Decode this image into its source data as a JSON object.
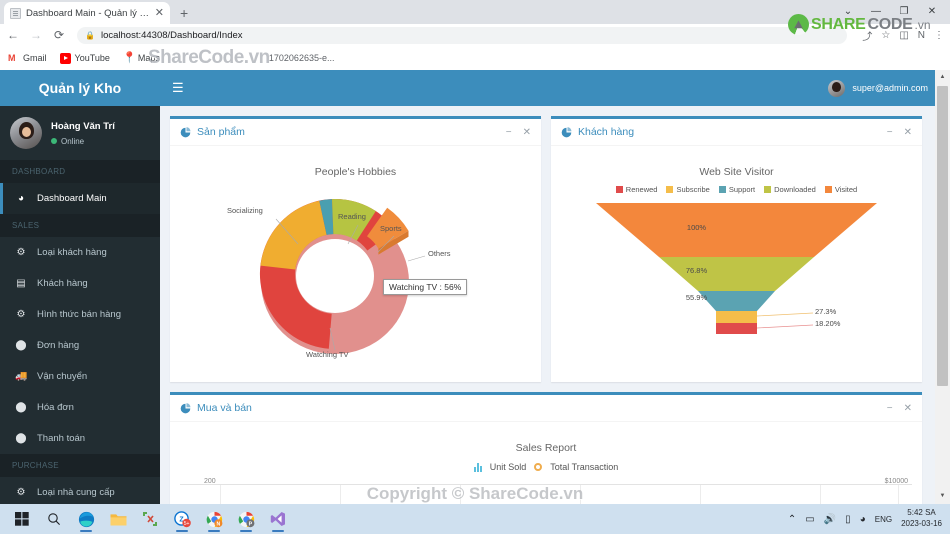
{
  "browser": {
    "tab_title": "Dashboard Main - Quản lý kho",
    "tab_close": "✕",
    "new_tab": "+",
    "back": "←",
    "forward": "→",
    "reload": "⟳",
    "lock": "🔒",
    "url": "localhost:44308/Dashboard/Index",
    "share_icon": "⤴",
    "star_icon": "☆",
    "reading_list_icon": "◫",
    "profile_initial": "N",
    "menu_icon": "⋮",
    "win_minimize": "—",
    "win_maximize": "❐",
    "win_close": "✕",
    "win_chevron": "⌄",
    "bookmarks": [
      {
        "label": "Gmail",
        "icon": "gmail-icon"
      },
      {
        "label": "YouTube",
        "icon": "youtube-icon"
      },
      {
        "label": "Maps",
        "icon": "maps-icon"
      },
      {
        "label": "1702062635-e...",
        "icon": "generic-bookmark-icon"
      }
    ]
  },
  "sidebar": {
    "brand": "Quản lý Kho",
    "user": {
      "name": "Hoàng Văn Trí",
      "status": "Online"
    },
    "sections": [
      {
        "header": "DASHBOARD",
        "items": [
          {
            "label": "Dashboard Main",
            "icon": "pie-chart-icon",
            "active": true
          }
        ]
      },
      {
        "header": "SALES",
        "items": [
          {
            "label": "Loại khách hàng",
            "icon": "gear-icon",
            "active": false
          },
          {
            "label": "Khách hàng",
            "icon": "book-icon",
            "active": false
          },
          {
            "label": "Hình thức bán hàng",
            "icon": "gear-icon",
            "active": false
          },
          {
            "label": "Đơn hàng",
            "icon": "circle-icon",
            "active": false
          },
          {
            "label": "Vận chuyển",
            "icon": "truck-icon",
            "active": false
          },
          {
            "label": "Hóa đơn",
            "icon": "circle-icon",
            "active": false
          },
          {
            "label": "Thanh toán",
            "icon": "circle-icon",
            "active": false
          }
        ]
      },
      {
        "header": "PURCHASE",
        "items": [
          {
            "label": "Loại nhà cung cấp",
            "icon": "gear-icon",
            "active": false
          }
        ]
      }
    ]
  },
  "navbar": {
    "hamburger": "☰",
    "user_email": "super@admin.com"
  },
  "boxes": {
    "products": {
      "title": "Sản phẩm",
      "minimize": "−",
      "close": "✕"
    },
    "customers": {
      "title": "Khách hàng",
      "minimize": "−",
      "close": "✕"
    },
    "buysell": {
      "title": "Mua và bán",
      "minimize": "−",
      "close": "✕"
    }
  },
  "chart_data": [
    {
      "type": "pie",
      "title": "People's Hobbies",
      "id": "donut",
      "labels": [
        "Watching TV",
        "Socializing",
        "Reading",
        "Sports",
        "Others"
      ],
      "values": [
        56,
        21,
        3,
        11,
        9
      ],
      "colors": [
        "#e0443e",
        "#f0ad30",
        "#4a9fb0",
        "#b6c442",
        "#f08c3c"
      ],
      "tooltip": "Watching TV : 56%",
      "donut": true,
      "legend": "none"
    },
    {
      "type": "funnel",
      "title": "Web Site Visitor",
      "id": "funnel",
      "legend_position": "top",
      "stages": [
        {
          "name": "Visited",
          "value": "100%",
          "color": "#f3873c"
        },
        {
          "name": "Downloaded",
          "value": "76.8%",
          "color": "#bfc446"
        },
        {
          "name": "Support",
          "value": "55.9%",
          "color": "#5ba3b2"
        },
        {
          "name": "Subscribe",
          "value": "27.3%",
          "color": "#f5bd4a"
        },
        {
          "name": "Renewed",
          "value": "18.20%",
          "color": "#e04b4b"
        }
      ],
      "legend": [
        "Renewed",
        "Subscribe",
        "Support",
        "Downloaded",
        "Visited"
      ],
      "legend_colors": [
        "#e04b4b",
        "#f5bd4a",
        "#5ba3b2",
        "#bfc446",
        "#f3873c"
      ]
    },
    {
      "type": "bar",
      "title": "Sales Report",
      "id": "sales",
      "series": [
        {
          "name": "Unit Sold",
          "values": []
        },
        {
          "name": "Total Transaction",
          "values": []
        }
      ],
      "legend": [
        "Unit Sold",
        "Total Transaction"
      ],
      "y_left_max": "200",
      "y_right_max": "$10000",
      "ylabel": "",
      "xlabel": "",
      "grid": true
    }
  ],
  "taskbar": {
    "apps": [
      {
        "name": "start-button"
      },
      {
        "name": "search-button"
      },
      {
        "name": "edge-app"
      },
      {
        "name": "file-explorer-app"
      },
      {
        "name": "app-4"
      },
      {
        "name": "app-5"
      },
      {
        "name": "chrome-app"
      },
      {
        "name": "chrome-app-2"
      },
      {
        "name": "visual-studio-app"
      }
    ],
    "tray": {
      "chevron": "⌃",
      "lang": "ENG",
      "time": "5:42 SA",
      "date": "2023-03-16"
    }
  },
  "watermarks": {
    "center": "Copyright © ShareCode.vn",
    "bookmark_bar": "ShareCode.vn",
    "logo_share": "SHARE",
    "logo_code": "CODE",
    "logo_vn": ".vn"
  },
  "scrollbar": {
    "up": "▲",
    "down": "▼"
  }
}
